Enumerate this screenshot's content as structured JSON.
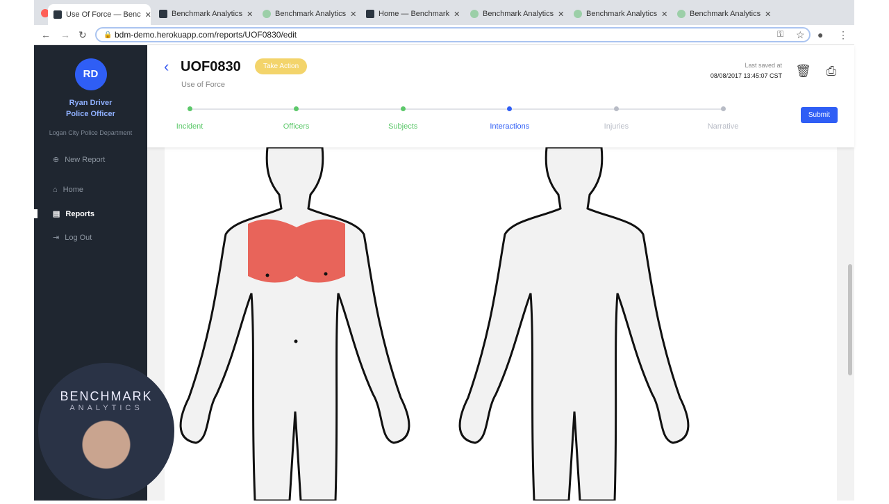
{
  "browser": {
    "tabs": [
      {
        "title": "Use Of Force — Benc",
        "icon": "react-icon",
        "active": true
      },
      {
        "title": "Benchmark Analytics",
        "icon": "react-icon"
      },
      {
        "title": "Benchmark Analytics",
        "icon": "gear-green-icon"
      },
      {
        "title": "Home — Benchmark",
        "icon": "react-icon"
      },
      {
        "title": "Benchmark Analytics",
        "icon": "gear-green-icon"
      },
      {
        "title": "Benchmark Analytics",
        "icon": "gear-green-icon"
      },
      {
        "title": "Benchmark Analytics",
        "icon": "gear-green-icon"
      }
    ],
    "url": "bdm-demo.herokuapp.com/reports/UOF0830/edit"
  },
  "sidebar": {
    "initials": "RD",
    "name": "Ryan Driver",
    "role": "Police Officer",
    "department": "Logan City Police Department",
    "items": [
      {
        "label": "New Report",
        "icon": "plus-circle-icon"
      },
      {
        "label": "Home",
        "icon": "home-icon"
      },
      {
        "label": "Reports",
        "icon": "document-icon",
        "active": true
      },
      {
        "label": "Log Out",
        "icon": "logout-icon"
      }
    ]
  },
  "header": {
    "title": "UOF0830",
    "badge": "Take Action",
    "subtitle": "Use of Force",
    "saved_label": "Last saved at",
    "saved_time": "08/08/2017 13:45:07 CST",
    "submit": "Submit",
    "steps": [
      {
        "label": "Incident",
        "state": "done"
      },
      {
        "label": "Officers",
        "state": "done"
      },
      {
        "label": "Subjects",
        "state": "done"
      },
      {
        "label": "Interactions",
        "state": "current"
      },
      {
        "label": "Injuries",
        "state": "todo"
      },
      {
        "label": "Narrative",
        "state": "todo"
      }
    ]
  },
  "colors": {
    "accent": "#2f5ef5",
    "done": "#5cc86a",
    "todo": "#b8bcc6",
    "highlight": "#e8645a",
    "badge": "#f3d46b"
  },
  "body_map": {
    "selected_regions": [
      "chest"
    ]
  },
  "video_overlay": {
    "logo": "BENCHMARK",
    "logo_sub": "ANALYTICS"
  }
}
